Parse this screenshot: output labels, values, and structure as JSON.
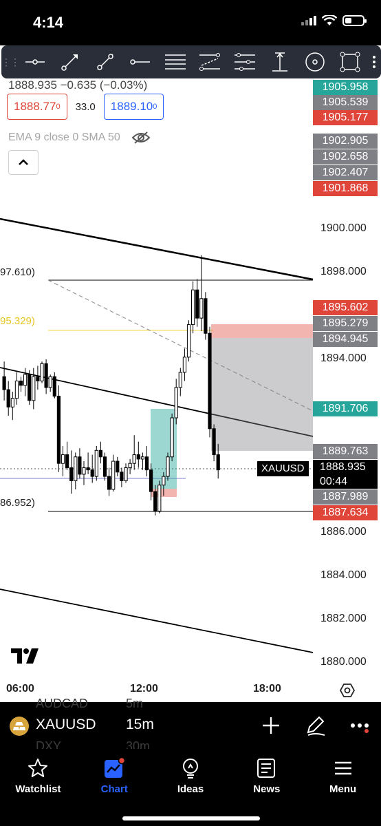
{
  "status_bar": {
    "time": "4:14"
  },
  "drawing_tools": [
    "horizontal-ray-icon",
    "trend-arrow-icon",
    "trend-line-icon",
    "horizontal-line-icon",
    "parallel-channel-icon",
    "fib-retracement-icon",
    "pitchfork-icon",
    "long-position-icon",
    "circle-icon",
    "rectangle-icon"
  ],
  "legend": {
    "ohlc": "1888.935  −0.635 (−0.03%)",
    "sell_price": "1888.77",
    "sell_price_sup": "0",
    "spread": "33.0",
    "buy_price": "1889.10",
    "buy_price_sup": "0",
    "indicators": "EMA 9 close 0 SMA 50"
  },
  "left_labels": {
    "top": "97.610)",
    "yellow": "95.329)",
    "bottom": "86.952)"
  },
  "price_tags": [
    {
      "value": "1905.958",
      "color": "#26a69a",
      "y": 0
    },
    {
      "value": "1905.539",
      "color": "#7f7f86",
      "y": 0
    },
    {
      "value": "1905.177",
      "color": "#e0453a",
      "y": 0
    },
    {
      "value": "1902.905",
      "color": "#7f7f86",
      "y": 0
    },
    {
      "value": "1902.658",
      "color": "#7f7f86",
      "y": 0
    },
    {
      "value": "1902.407",
      "color": "#7f7f86",
      "y": 0
    },
    {
      "value": "1901.868",
      "color": "#e0453a",
      "y": 0
    },
    {
      "value": "1895.602",
      "color": "#e0453a",
      "y": 0
    },
    {
      "value": "1895.279",
      "color": "#7f7f86",
      "y": 0
    },
    {
      "value": "1894.945",
      "color": "#7f7f86",
      "y": 0
    },
    {
      "value": "1891.706",
      "color": "#26a69a",
      "y": 0
    },
    {
      "value": "1889.763",
      "color": "#7f7f86",
      "y": 0
    },
    {
      "value": "1887.989",
      "color": "#7f7f86",
      "y": 0
    },
    {
      "value": "1887.634",
      "color": "#e0453a",
      "y": 0
    }
  ],
  "axis_prices": [
    "1900.000",
    "1898.000",
    "1894.000",
    "1886.000",
    "1884.000",
    "1882.000",
    "1880.000"
  ],
  "current": {
    "symbol_label": "XAUUSD",
    "price": "1888.935",
    "countdown": "00:44"
  },
  "time_axis": [
    "06:00",
    "12:00",
    "18:00"
  ],
  "symbol_bar": {
    "symbol": "XAUUSD",
    "timeframe": "15m",
    "ghost_top_symbol": "AUDCAD",
    "ghost_top_tf": "5m",
    "ghost_bottom_symbol": "DXY",
    "ghost_bottom_tf": "30m"
  },
  "nav": [
    {
      "label": "Watchlist",
      "icon": "star-icon",
      "active": false
    },
    {
      "label": "Chart",
      "icon": "chart-icon",
      "active": true
    },
    {
      "label": "Ideas",
      "icon": "lightbulb-icon",
      "active": false
    },
    {
      "label": "News",
      "icon": "news-icon",
      "active": false
    },
    {
      "label": "Menu",
      "icon": "menu-icon",
      "active": false
    }
  ],
  "chart_data": {
    "type": "candlestick",
    "symbol": "XAUUSD",
    "timeframe": "15m",
    "ylim": [
      1879,
      1908
    ],
    "candles": [
      [
        1893.2,
        1893.9,
        1892.1,
        1892.6
      ],
      [
        1892.6,
        1893.0,
        1891.4,
        1891.8
      ],
      [
        1891.8,
        1892.5,
        1891.2,
        1892.2
      ],
      [
        1892.2,
        1893.4,
        1891.9,
        1893.0
      ],
      [
        1893.0,
        1893.2,
        1892.5,
        1892.8
      ],
      [
        1892.8,
        1893.6,
        1892.3,
        1893.3
      ],
      [
        1893.3,
        1893.5,
        1891.9,
        1892.1
      ],
      [
        1892.1,
        1893.6,
        1891.7,
        1893.2
      ],
      [
        1893.2,
        1893.7,
        1892.6,
        1893.0
      ],
      [
        1893.0,
        1893.9,
        1892.9,
        1893.8
      ],
      [
        1893.8,
        1894.0,
        1892.4,
        1892.7
      ],
      [
        1892.7,
        1893.3,
        1892.5,
        1893.2
      ],
      [
        1893.2,
        1893.4,
        1892.2,
        1892.3
      ],
      [
        1892.3,
        1892.8,
        1888.8,
        1889.2
      ],
      [
        1889.2,
        1890.0,
        1888.6,
        1889.6
      ],
      [
        1889.6,
        1890.2,
        1888.9,
        1889.0
      ],
      [
        1889.0,
        1889.8,
        1887.8,
        1888.4
      ],
      [
        1888.4,
        1889.7,
        1888.0,
        1889.5
      ],
      [
        1889.5,
        1889.9,
        1888.5,
        1888.7
      ],
      [
        1888.7,
        1889.3,
        1888.2,
        1889.0
      ],
      [
        1889.0,
        1889.7,
        1888.7,
        1888.9
      ],
      [
        1888.9,
        1889.6,
        1888.3,
        1888.6
      ],
      [
        1888.6,
        1890.0,
        1888.4,
        1889.8
      ],
      [
        1889.8,
        1890.2,
        1889.2,
        1889.5
      ],
      [
        1889.5,
        1889.7,
        1888.4,
        1888.6
      ],
      [
        1888.6,
        1889.0,
        1887.7,
        1888.0
      ],
      [
        1888.0,
        1889.6,
        1887.9,
        1889.3
      ],
      [
        1889.3,
        1889.5,
        1888.6,
        1888.8
      ],
      [
        1888.8,
        1889.0,
        1888.1,
        1888.4
      ],
      [
        1888.4,
        1889.2,
        1888.3,
        1889.0
      ],
      [
        1889.0,
        1889.4,
        1888.7,
        1889.2
      ],
      [
        1889.2,
        1890.5,
        1888.9,
        1889.6
      ],
      [
        1889.6,
        1890.2,
        1889.0,
        1889.4
      ],
      [
        1889.4,
        1889.7,
        1888.9,
        1889.5
      ],
      [
        1889.5,
        1890.0,
        1888.6,
        1888.9
      ],
      [
        1888.9,
        1889.2,
        1887.5,
        1887.9
      ],
      [
        1887.9,
        1888.2,
        1886.8,
        1887.0
      ],
      [
        1887.0,
        1888.4,
        1886.9,
        1888.2
      ],
      [
        1888.2,
        1888.8,
        1887.7,
        1888.6
      ],
      [
        1888.6,
        1889.7,
        1888.4,
        1889.5
      ],
      [
        1889.5,
        1891.5,
        1889.3,
        1891.3
      ],
      [
        1891.3,
        1893.1,
        1891.0,
        1892.7
      ],
      [
        1892.7,
        1893.6,
        1892.3,
        1893.4
      ],
      [
        1893.4,
        1894.5,
        1893.0,
        1894.1
      ],
      [
        1894.1,
        1895.8,
        1893.9,
        1895.6
      ],
      [
        1895.6,
        1897.6,
        1895.2,
        1897.2
      ],
      [
        1897.2,
        1897.7,
        1895.5,
        1895.9
      ],
      [
        1895.9,
        1898.8,
        1895.3,
        1896.8
      ],
      [
        1896.8,
        1897.1,
        1894.9,
        1895.2
      ],
      [
        1895.2,
        1895.5,
        1890.4,
        1890.8
      ],
      [
        1890.8,
        1891.0,
        1889.3,
        1889.6
      ],
      [
        1889.6,
        1890.1,
        1888.5,
        1888.9
      ]
    ]
  }
}
